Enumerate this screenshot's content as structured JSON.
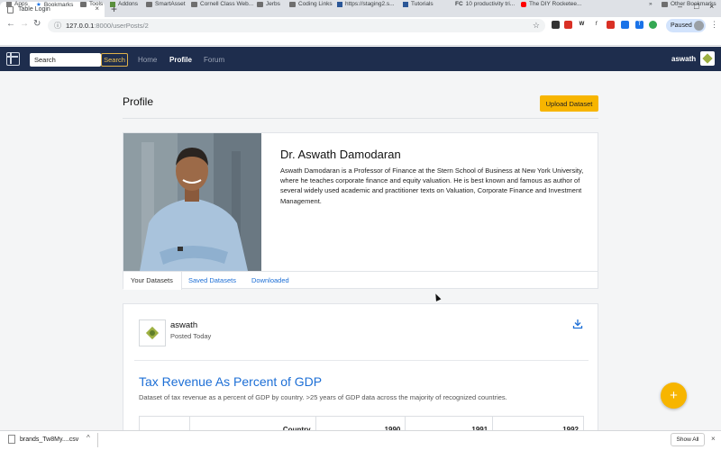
{
  "browser": {
    "tab_title": "Table Login",
    "tab_close": "×",
    "new_tab": "+",
    "url_host": "127.0.0.1",
    "url_path": ":8000/userPosts/2",
    "profile_status": "Paused",
    "bookmarks": [
      {
        "label": "Apps",
        "icon": "apps-grid-icon"
      },
      {
        "label": "Bookmarks",
        "icon": "star-icon"
      },
      {
        "label": "Tools",
        "icon": "folder-icon"
      },
      {
        "label": "Addons",
        "icon": "puzzle-icon"
      },
      {
        "label": "SmartAsset",
        "icon": "folder-icon"
      },
      {
        "label": "Cornell Class Web...",
        "icon": "folder-icon"
      },
      {
        "label": "Jerbs",
        "icon": "folder-icon"
      },
      {
        "label": "Coding Links",
        "icon": "folder-icon"
      },
      {
        "label": "https://staging2.s...",
        "icon": "site-icon"
      },
      {
        "label": "Tutorials",
        "icon": "site-icon"
      },
      {
        "label": "10 productivity tri...",
        "icon": "fc-icon"
      },
      {
        "label": "The DIY Rocketee...",
        "icon": "youtube-icon"
      }
    ],
    "overflow_chevron": "»",
    "other_bookmarks": "Other Bookmarks",
    "download": {
      "filename": "brands_Tw8My....csv",
      "show_all": "Show All"
    }
  },
  "navbar": {
    "search_placeholder": "Search",
    "search_button": "Search",
    "links": [
      "Home",
      "Profile",
      "Forum"
    ],
    "active_link": "Profile",
    "username": "aswath"
  },
  "page": {
    "title": "Profile",
    "upload_button": "Upload Dataset"
  },
  "profile": {
    "name": "Dr. Aswath Damodaran",
    "bio": "Aswath Damodaran is a Professor of Finance at the Stern School of Business at New York University, where he teaches corporate finance and equity valuation. He is best known and famous as author of several widely used academic and practitioner texts on Valuation, Corporate Finance and Investment Management.",
    "tabs": [
      "Your Datasets",
      "Saved Datasets",
      "Downloaded"
    ],
    "active_tab": "Your Datasets"
  },
  "dataset": {
    "user": "aswath",
    "posted": "Posted Today",
    "title": "Tax Revenue As Percent of GDP",
    "description": "Dataset of tax revenue as a percent of GDP by country. >25 years of GDP data across the majority of recognized countries.",
    "columns": [
      "",
      "Country",
      "1990",
      "1991",
      "1992"
    ]
  },
  "fab_label": "+",
  "colors": {
    "navbar_bg": "#1e2d4d",
    "accent_yellow": "#f7b500",
    "link_blue": "#1d6fd6"
  }
}
